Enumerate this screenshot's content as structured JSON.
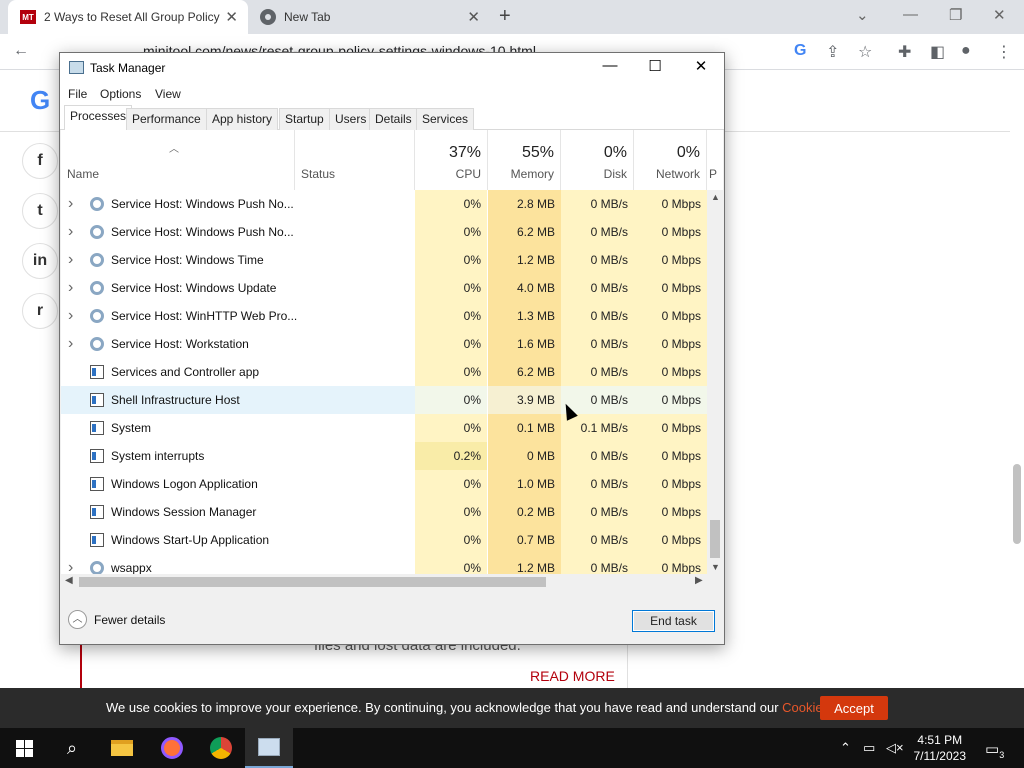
{
  "browser": {
    "tabs": [
      {
        "title": "2 Ways to Reset All Group Policy",
        "favicon": "minitool-icon"
      },
      {
        "title": "New Tab",
        "favicon": "chrome-icon"
      }
    ],
    "url": "minitool.com/news/reset-group-policy-settings-windows-10.html"
  },
  "page": {
    "logo": "G",
    "body_text": "files and lost data are included.",
    "read_more": "READ MORE",
    "social": [
      "f",
      "t",
      "in",
      "r"
    ]
  },
  "cookie": {
    "text": "We use cookies to improve your experience. By continuing, you acknowledge that you have read and understand our ",
    "link": "Cookie Policy",
    "suffix": ".",
    "accept": "Accept"
  },
  "taskbar": {
    "time": "4:51 PM",
    "date": "7/11/2023",
    "notif_count": "3"
  },
  "task_manager": {
    "title": "Task Manager",
    "menu": [
      "File",
      "Options",
      "View"
    ],
    "tabs": [
      "Processes",
      "Performance",
      "App history",
      "Startup",
      "Users",
      "Details",
      "Services"
    ],
    "active_tab": "Processes",
    "columns": {
      "name": "Name",
      "status": "Status",
      "cpu": {
        "pct": "37%",
        "label": "CPU"
      },
      "memory": {
        "pct": "55%",
        "label": "Memory"
      },
      "disk": {
        "pct": "0%",
        "label": "Disk"
      },
      "network": {
        "pct": "0%",
        "label": "Network"
      },
      "power": "P"
    },
    "rows": [
      {
        "name": "Service Host: Windows Push No...",
        "icon": "gear",
        "expand": true,
        "cpu": "0%",
        "memory": "2.8 MB",
        "disk": "0 MB/s",
        "network": "0 Mbps"
      },
      {
        "name": "Service Host: Windows Push No...",
        "icon": "gear",
        "expand": true,
        "cpu": "0%",
        "memory": "6.2 MB",
        "disk": "0 MB/s",
        "network": "0 Mbps"
      },
      {
        "name": "Service Host: Windows Time",
        "icon": "gear",
        "expand": true,
        "cpu": "0%",
        "memory": "1.2 MB",
        "disk": "0 MB/s",
        "network": "0 Mbps"
      },
      {
        "name": "Service Host: Windows Update",
        "icon": "gear",
        "expand": true,
        "cpu": "0%",
        "memory": "4.0 MB",
        "disk": "0 MB/s",
        "network": "0 Mbps"
      },
      {
        "name": "Service Host: WinHTTP Web Pro...",
        "icon": "gear",
        "expand": true,
        "cpu": "0%",
        "memory": "1.3 MB",
        "disk": "0 MB/s",
        "network": "0 Mbps"
      },
      {
        "name": "Service Host: Workstation",
        "icon": "gear",
        "expand": true,
        "cpu": "0%",
        "memory": "1.6 MB",
        "disk": "0 MB/s",
        "network": "0 Mbps"
      },
      {
        "name": "Services and Controller app",
        "icon": "win",
        "expand": false,
        "cpu": "0%",
        "memory": "6.2 MB",
        "disk": "0 MB/s",
        "network": "0 Mbps"
      },
      {
        "name": "Shell Infrastructure Host",
        "icon": "win",
        "expand": false,
        "cpu": "0%",
        "memory": "3.9 MB",
        "disk": "0 MB/s",
        "network": "0 Mbps",
        "selected": true
      },
      {
        "name": "System",
        "icon": "win",
        "expand": false,
        "cpu": "0%",
        "memory": "0.1 MB",
        "disk": "0.1 MB/s",
        "network": "0 Mbps"
      },
      {
        "name": "System interrupts",
        "icon": "win",
        "expand": false,
        "cpu": "0.2%",
        "memory": "0 MB",
        "disk": "0 MB/s",
        "network": "0 Mbps"
      },
      {
        "name": "Windows Logon Application",
        "icon": "win",
        "expand": false,
        "cpu": "0%",
        "memory": "1.0 MB",
        "disk": "0 MB/s",
        "network": "0 Mbps"
      },
      {
        "name": "Windows Session Manager",
        "icon": "win",
        "expand": false,
        "cpu": "0%",
        "memory": "0.2 MB",
        "disk": "0 MB/s",
        "network": "0 Mbps"
      },
      {
        "name": "Windows Start-Up Application",
        "icon": "win",
        "expand": false,
        "cpu": "0%",
        "memory": "0.7 MB",
        "disk": "0 MB/s",
        "network": "0 Mbps"
      },
      {
        "name": "wsappx",
        "icon": "gear",
        "expand": true,
        "cpu": "0%",
        "memory": "1.2 MB",
        "disk": "0 MB/s",
        "network": "0 Mbps"
      }
    ],
    "footer": {
      "fewer_details": "Fewer details",
      "end_task": "End task"
    }
  },
  "colors": {
    "cpu_bg": "#fff4c4",
    "mem_bg": "#fce39d",
    "accent": "#0078d7",
    "brand_red": "#b3000c"
  }
}
